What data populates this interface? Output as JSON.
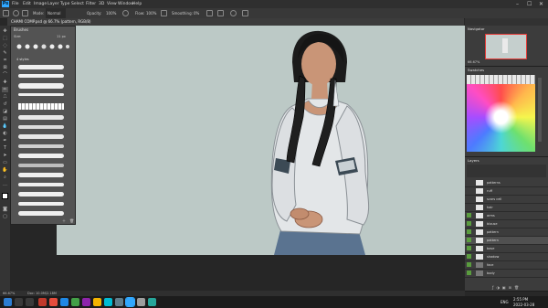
{
  "menubar": {
    "app_icon": "Ps",
    "items": [
      "File",
      "Edit",
      "Image",
      "Layer",
      "Type",
      "Select",
      "Filter",
      "3D",
      "View",
      "Window",
      "Help"
    ],
    "window_controls": [
      "–",
      "☐",
      "✕"
    ]
  },
  "options": {
    "mode_label": "Mode:",
    "mode_value": "Normal",
    "opacity_label": "Opacity:",
    "opacity_value": "100%",
    "flow_label": "Flow:",
    "flow_value": "100%",
    "smoothing_label": "Smoothing:",
    "smoothing_value": "0%"
  },
  "document": {
    "tab_title": "CHAMI COMP.psd @ 66.7% (pattern, RGB/8)"
  },
  "brushes_panel": {
    "title": "Brushes",
    "size_label": "Size:",
    "size_value": "11 px",
    "group_label": "4 styles"
  },
  "right_panels": {
    "navigator_title": "Navigator",
    "navigator_zoom": "66.67%",
    "swatches_title": "Swatches",
    "layers_title": "Layers",
    "layers": [
      {
        "name": "patterns",
        "eye": false
      },
      {
        "name": "ruff",
        "eye": false
      },
      {
        "name": "scars cell",
        "eye": false
      },
      {
        "name": "hair",
        "eye": false
      },
      {
        "name": "arms",
        "eye": true
      },
      {
        "name": "blouse",
        "eye": true
      },
      {
        "name": "pattern",
        "eye": true
      },
      {
        "name": "pattern",
        "eye": true
      },
      {
        "name": "base",
        "eye": true
      },
      {
        "name": "shadow",
        "eye": true
      },
      {
        "name": "face",
        "eye": true
      },
      {
        "name": "body",
        "eye": true
      }
    ]
  },
  "status": {
    "zoom": "66.67%",
    "doc": "Doc: 10.0M/2.18M"
  },
  "taskbar": {
    "time": "2:55 PM",
    "date": "2022-03-28",
    "lang": "ENG",
    "apps": [
      "#c0392b",
      "#e74c3c",
      "#1e88e5",
      "#43a047",
      "#8e24aa",
      "#f4b400",
      "#00bcd4",
      "#607d8b",
      "#31a8ff",
      "#9e9e9e",
      "#26a69a"
    ]
  },
  "colors": {
    "canvas_bg": "#bcc9c6",
    "panel_bg": "#535353",
    "accent": "#31a8ff"
  }
}
